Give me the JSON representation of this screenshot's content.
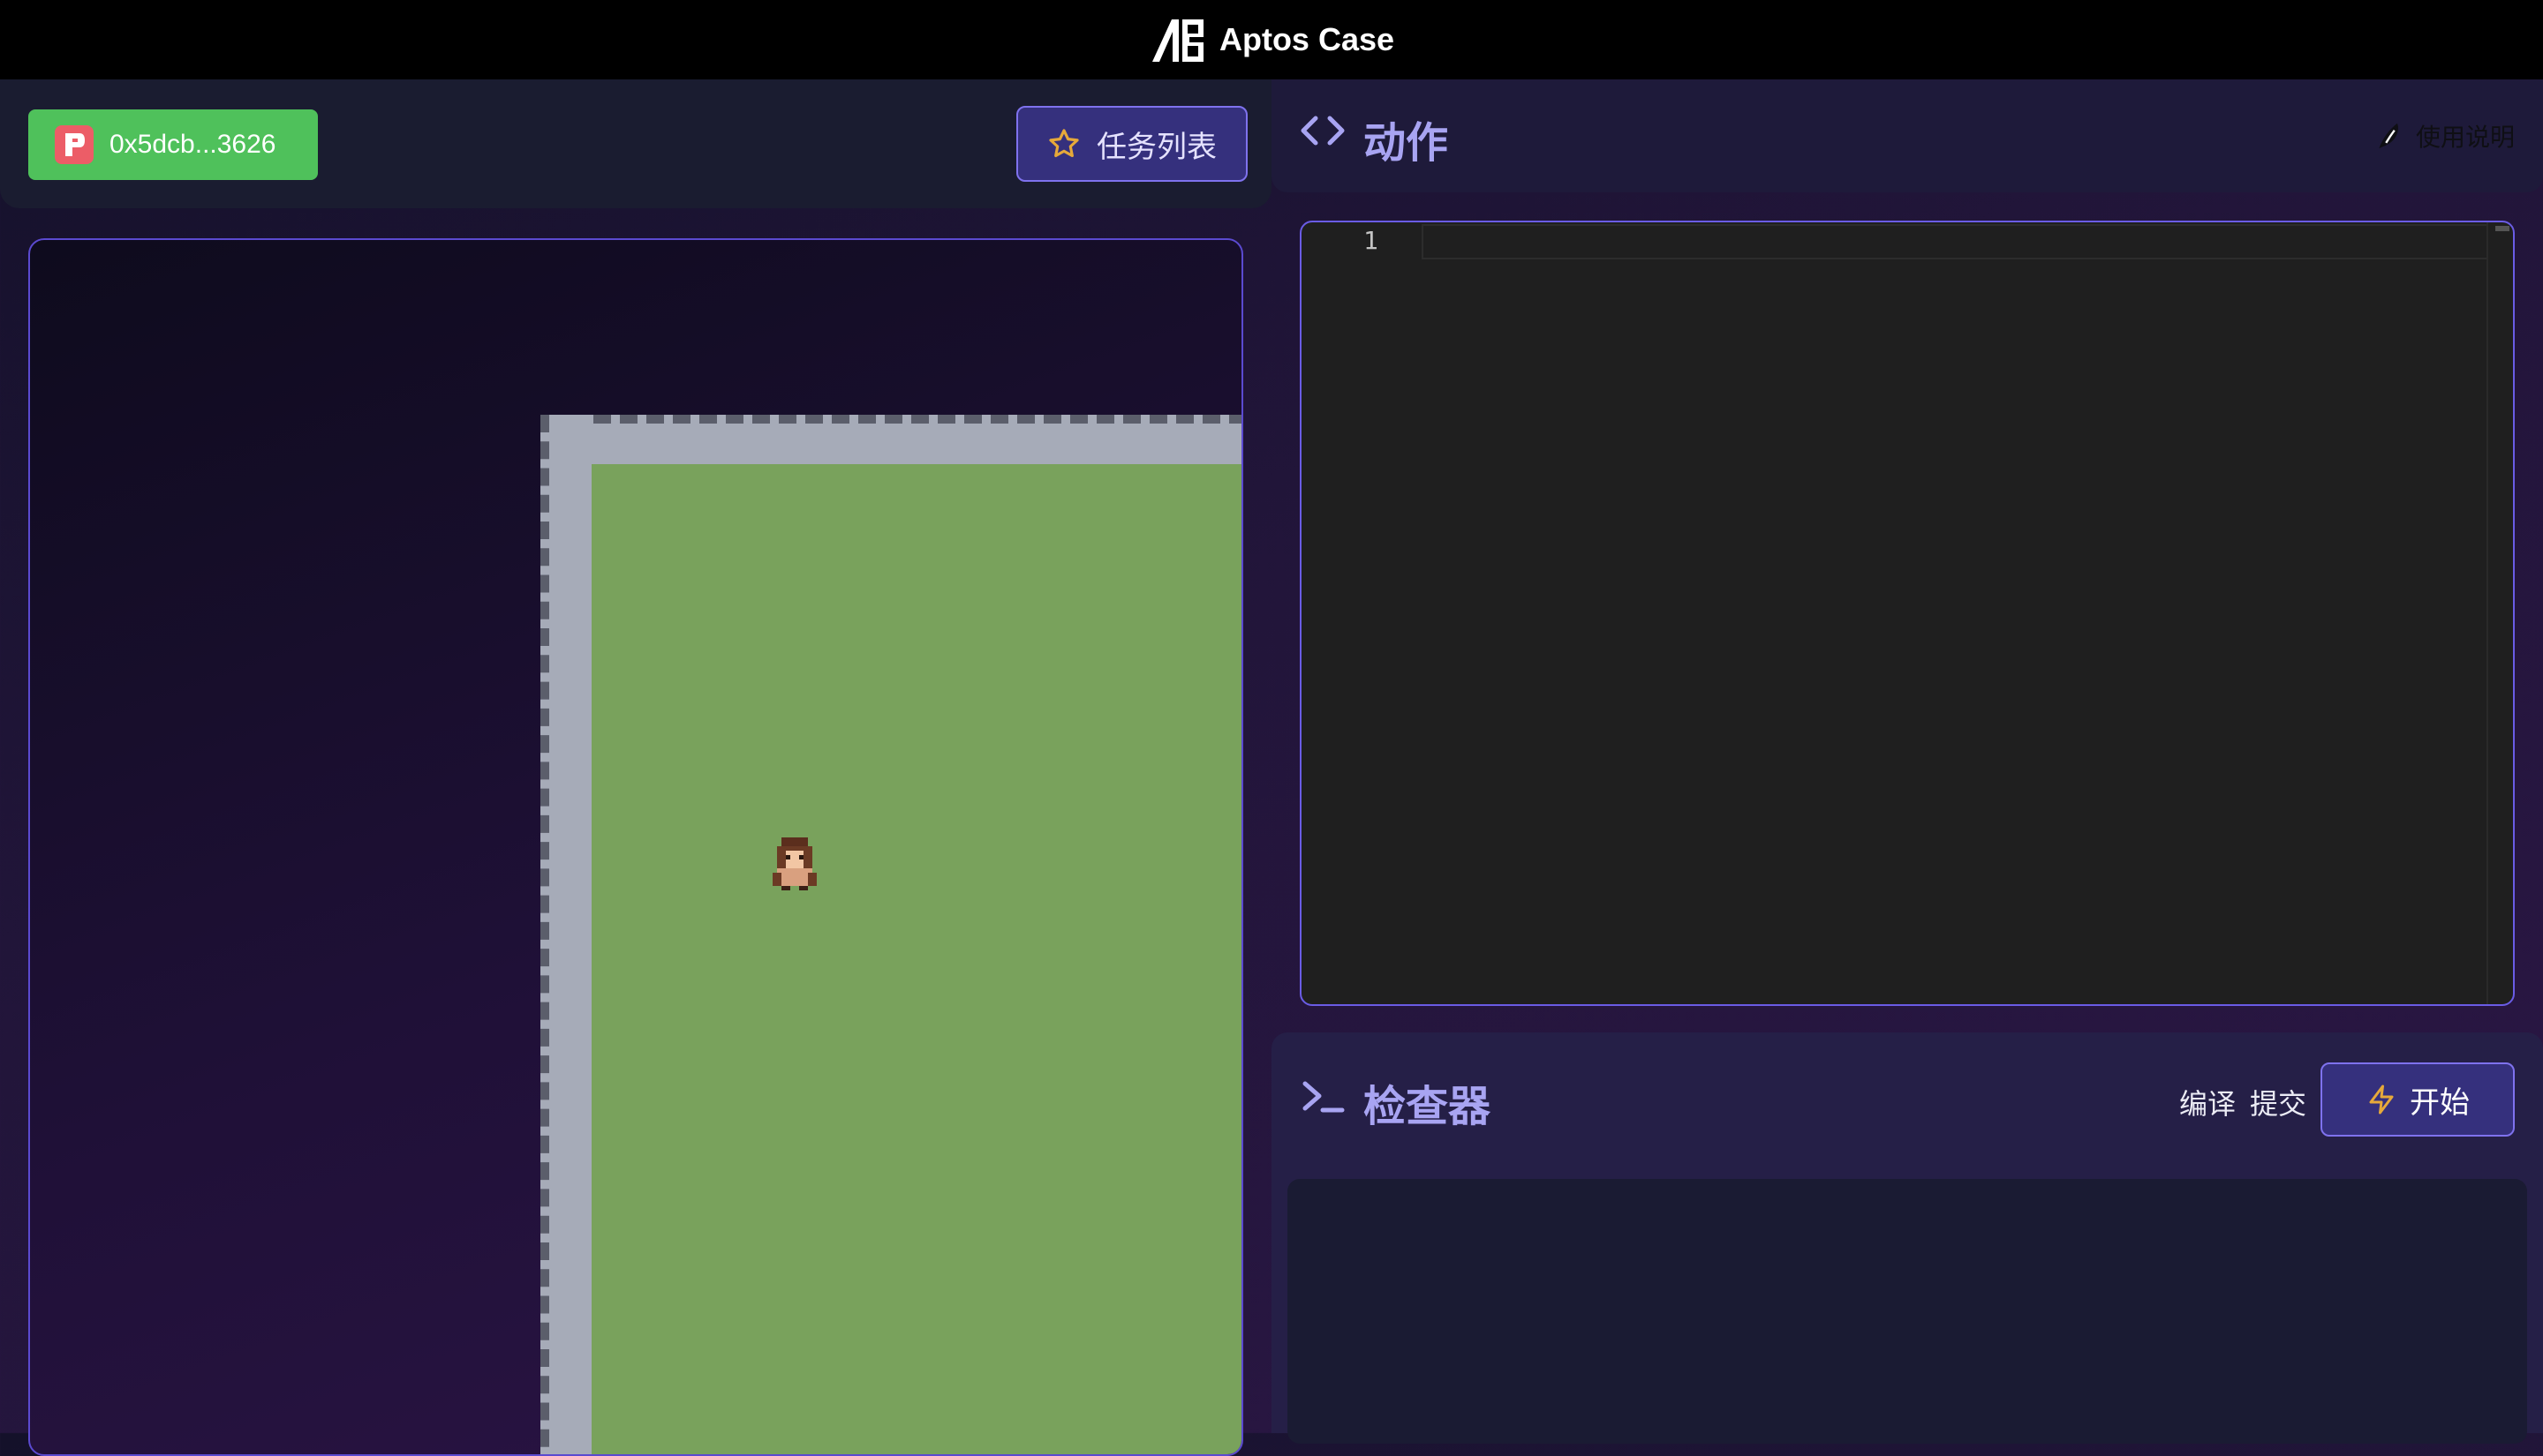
{
  "app": {
    "title": "Aptos Case"
  },
  "wallet": {
    "address": "0x5dcb...3626"
  },
  "tasks": {
    "label": "任务列表"
  },
  "action": {
    "title": "动作",
    "help_label": "使用说明"
  },
  "editor": {
    "line_number": "1"
  },
  "inspector": {
    "title": "检查器",
    "compile_label": "编译",
    "submit_label": "提交",
    "start_label": "开始"
  },
  "colors": {
    "wallet_bg": "#4fc15b",
    "accent": "#7f72ee",
    "button_bg": "#35307d",
    "grass": "#79a25c",
    "wall": "#a6abb8",
    "editor_bg": "#1f1f1f"
  },
  "icons": [
    "logo-icon",
    "wallet-icon",
    "star-icon",
    "code-icon",
    "help-icon",
    "terminal-icon",
    "lightning-icon"
  ]
}
